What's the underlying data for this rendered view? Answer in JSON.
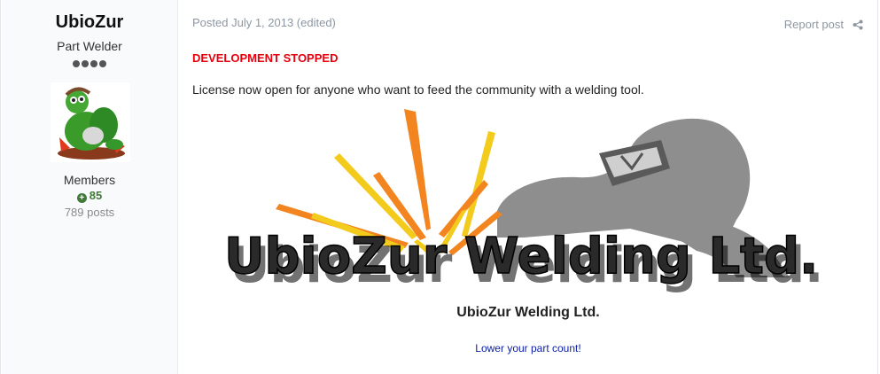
{
  "author": {
    "name": "UbioZur",
    "title": "Part Welder",
    "rank_pips": 4,
    "group": "Members",
    "reputation": "85",
    "posts": "789 posts"
  },
  "post": {
    "meta": "Posted July 1, 2013 (edited)",
    "report_label": "Report post",
    "headline": "DEVELOPMENT STOPPED",
    "body": "License now open for anyone who want to feed the community with a welding tool.",
    "banner_text": "UbioZur Welding Ltd.",
    "caption_title": "UbioZur Welding Ltd.",
    "caption_link": "Lower your part count!"
  },
  "icons": {
    "share": "share-icon",
    "reputation": "plus-circle-icon"
  },
  "colors": {
    "headline": "#e8000d",
    "link": "#0b1ea8",
    "reputation": "#3f7a36",
    "meta": "#8d97a3"
  }
}
